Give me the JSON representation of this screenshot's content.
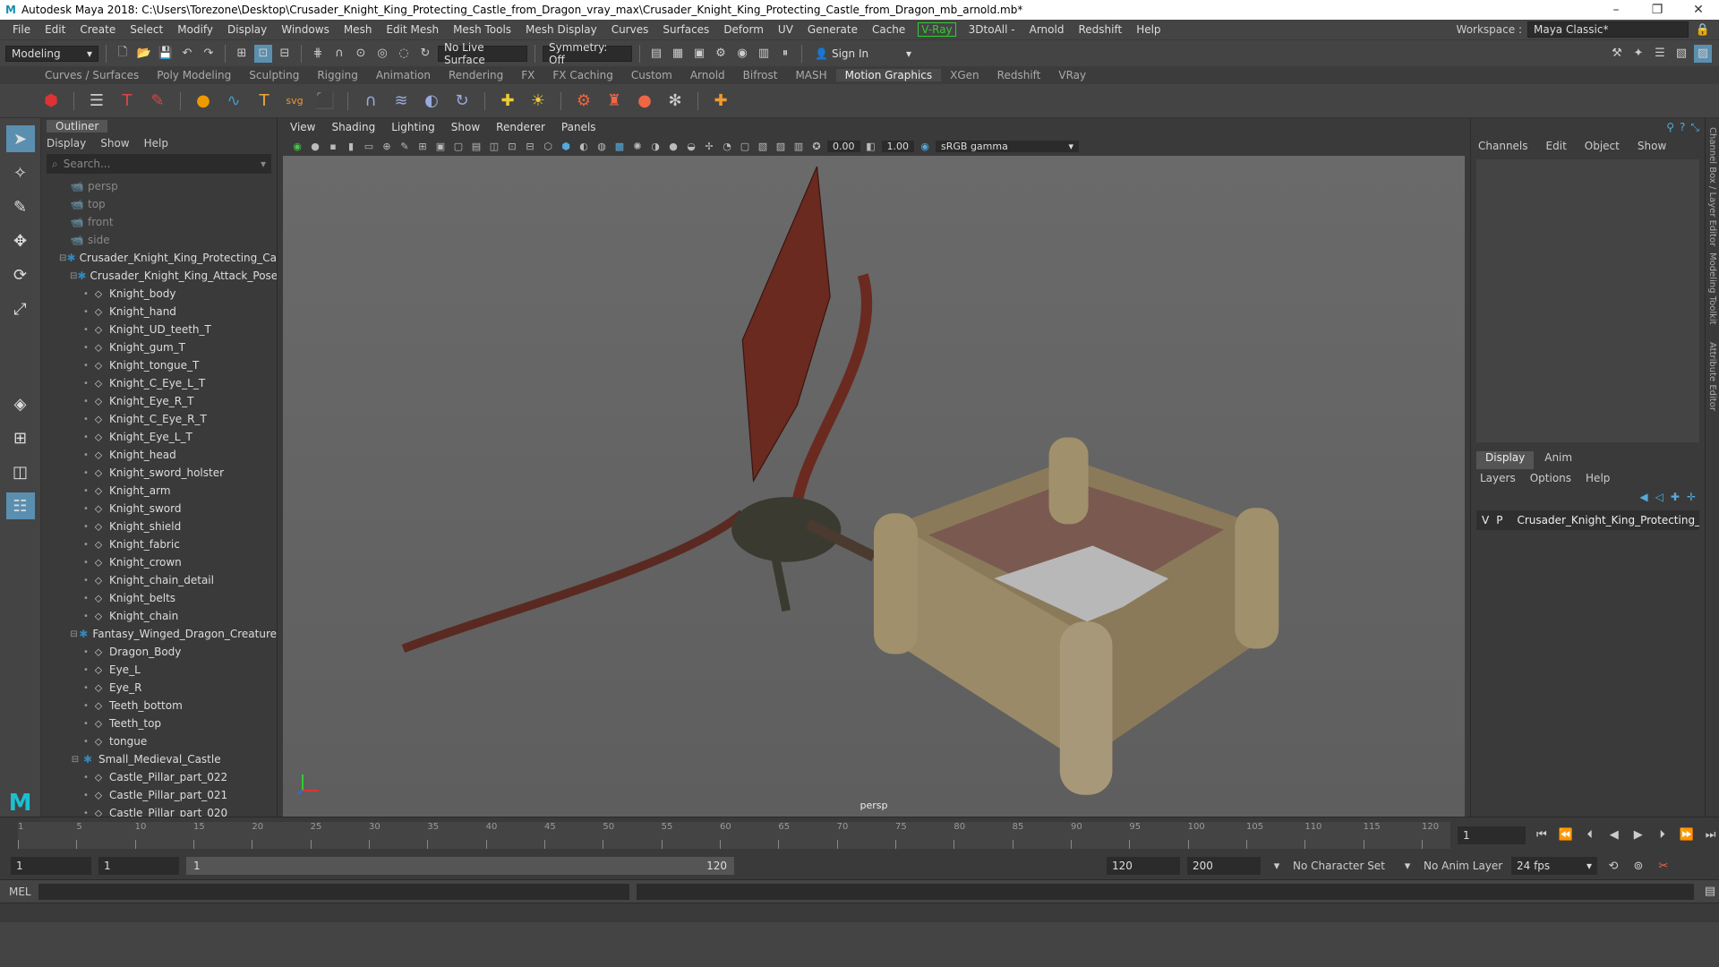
{
  "window": {
    "title": "Autodesk Maya 2018: C:\\Users\\Torezone\\Desktop\\Crusader_Knight_King_Protecting_Castle_from_Dragon_vray_max\\Crusader_Knight_King_Protecting_Castle_from_Dragon_mb_arnold.mb*",
    "minimize": "–",
    "restore": "❐",
    "close": "✕"
  },
  "menubar": {
    "items": [
      "File",
      "Edit",
      "Create",
      "Select",
      "Modify",
      "Display",
      "Windows",
      "Mesh",
      "Edit Mesh",
      "Mesh Tools",
      "Mesh Display",
      "Curves",
      "Surfaces",
      "Deform",
      "UV",
      "Generate",
      "Cache"
    ],
    "vray": "V-Ray",
    "items2": [
      "3DtoAll -",
      "Arnold",
      "Redshift",
      "Help"
    ],
    "workspace_label": "Workspace :",
    "workspace_value": "Maya Classic*"
  },
  "statusline": {
    "mode": "Modeling",
    "live_surface": "No Live Surface",
    "symmetry": "Symmetry: Off",
    "sign_in": "Sign In"
  },
  "shelf": {
    "tabs": [
      "Curves / Surfaces",
      "Poly Modeling",
      "Sculpting",
      "Rigging",
      "Animation",
      "Rendering",
      "FX",
      "FX Caching",
      "Custom",
      "Arnold",
      "Bifrost",
      "MASH",
      "Motion Graphics",
      "XGen",
      "Redshift",
      "VRay"
    ],
    "active": "Motion Graphics"
  },
  "outliner": {
    "title": "Outliner",
    "menu": [
      "Display",
      "Show",
      "Help"
    ],
    "search_placeholder": "Search...",
    "nodes": [
      {
        "label": "persp",
        "type": "camera",
        "indent": 0,
        "dim": true
      },
      {
        "label": "top",
        "type": "camera",
        "indent": 0,
        "dim": true
      },
      {
        "label": "front",
        "type": "camera",
        "indent": 0,
        "dim": true
      },
      {
        "label": "side",
        "type": "camera",
        "indent": 0,
        "dim": true
      },
      {
        "label": "Crusader_Knight_King_Protecting_Ca",
        "type": "group",
        "indent": 0,
        "toggle": "⊟"
      },
      {
        "label": "Crusader_Knight_King_Attack_Pose",
        "type": "group",
        "indent": 1,
        "toggle": "⊟"
      },
      {
        "label": "Knight_body",
        "type": "mesh",
        "indent": 2
      },
      {
        "label": "Knight_hand",
        "type": "mesh",
        "indent": 2
      },
      {
        "label": "Knight_UD_teeth_T",
        "type": "mesh",
        "indent": 2
      },
      {
        "label": "Knight_gum_T",
        "type": "mesh",
        "indent": 2
      },
      {
        "label": "Knight_tongue_T",
        "type": "mesh",
        "indent": 2
      },
      {
        "label": "Knight_C_Eye_L_T",
        "type": "mesh",
        "indent": 2
      },
      {
        "label": "Knight_Eye_R_T",
        "type": "mesh",
        "indent": 2
      },
      {
        "label": "Knight_C_Eye_R_T",
        "type": "mesh",
        "indent": 2
      },
      {
        "label": "Knight_Eye_L_T",
        "type": "mesh",
        "indent": 2
      },
      {
        "label": "Knight_head",
        "type": "mesh",
        "indent": 2
      },
      {
        "label": "Knight_sword_holster",
        "type": "mesh",
        "indent": 2
      },
      {
        "label": "Knight_arm",
        "type": "mesh",
        "indent": 2
      },
      {
        "label": "Knight_sword",
        "type": "mesh",
        "indent": 2
      },
      {
        "label": "Knight_shield",
        "type": "mesh",
        "indent": 2
      },
      {
        "label": "Knight_fabric",
        "type": "mesh",
        "indent": 2
      },
      {
        "label": "Knight_crown",
        "type": "mesh",
        "indent": 2
      },
      {
        "label": "Knight_chain_detail",
        "type": "mesh",
        "indent": 2
      },
      {
        "label": "Knight_belts",
        "type": "mesh",
        "indent": 2
      },
      {
        "label": "Knight_chain",
        "type": "mesh",
        "indent": 2
      },
      {
        "label": "Fantasy_Winged_Dragon_Creature",
        "type": "group",
        "indent": 1,
        "toggle": "⊟"
      },
      {
        "label": "Dragon_Body",
        "type": "mesh",
        "indent": 2
      },
      {
        "label": "Eye_L",
        "type": "mesh",
        "indent": 2
      },
      {
        "label": "Eye_R",
        "type": "mesh",
        "indent": 2
      },
      {
        "label": "Teeth_bottom",
        "type": "mesh",
        "indent": 2
      },
      {
        "label": "Teeth_top",
        "type": "mesh",
        "indent": 2
      },
      {
        "label": "tongue",
        "type": "mesh",
        "indent": 2
      },
      {
        "label": "Small_Medieval_Castle",
        "type": "group",
        "indent": 1,
        "toggle": "⊟"
      },
      {
        "label": "Castle_Pillar_part_022",
        "type": "mesh",
        "indent": 2
      },
      {
        "label": "Castle_Pillar_part_021",
        "type": "mesh",
        "indent": 2
      },
      {
        "label": "Castle_Pillar_part_020",
        "type": "mesh",
        "indent": 2
      }
    ]
  },
  "viewport": {
    "menu": [
      "View",
      "Shading",
      "Lighting",
      "Show",
      "Renderer",
      "Panels"
    ],
    "exposure": "0.00",
    "gamma": "1.00",
    "color_space": "sRGB gamma",
    "camera_label": "persp"
  },
  "channelbox": {
    "menu": [
      "Channels",
      "Edit",
      "Object",
      "Show"
    ]
  },
  "layers": {
    "tabs": [
      "Display",
      "Anim"
    ],
    "menu": [
      "Layers",
      "Options",
      "Help"
    ],
    "row": {
      "v": "V",
      "p": "P",
      "name": "Crusader_Knight_King_Protecting_C"
    },
    "swatch_color": "#b01c2e"
  },
  "side_tabs": [
    "Channel Box / Layer Editor",
    "Modeling Toolkit",
    "Attribute Editor"
  ],
  "timeslider": {
    "ticks": [
      "1",
      "5",
      "10",
      "15",
      "20",
      "25",
      "30",
      "35",
      "40",
      "45",
      "50",
      "55",
      "60",
      "65",
      "70",
      "75",
      "80",
      "85",
      "90",
      "95",
      "100",
      "105",
      "110",
      "115",
      "120"
    ],
    "current": "1"
  },
  "rangeslider": {
    "start": "1",
    "playback_start": "1",
    "range_start": "1",
    "range_end": "120",
    "playback_end": "120",
    "end": "200",
    "character_set": "No Character Set",
    "anim_layer": "No Anim Layer",
    "fps": "24 fps"
  },
  "cmdline": {
    "label": "MEL"
  }
}
